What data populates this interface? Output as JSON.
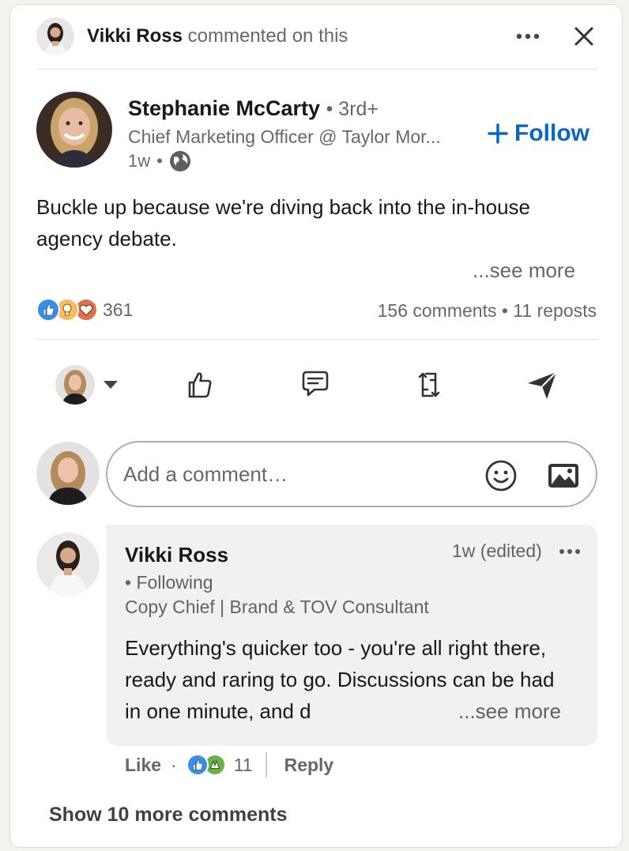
{
  "header": {
    "actor_name": "Vikki Ross",
    "action_text": "commented on this",
    "more_icon": "ellipsis-icon",
    "close_icon": "close-icon"
  },
  "post": {
    "author": {
      "name": "Stephanie McCarty",
      "degree": "3rd+",
      "headline": "Chief Marketing Officer @ Taylor Mor...",
      "time": "1w",
      "visibility_icon": "globe-icon"
    },
    "follow_label": "Follow",
    "text": "Buckle up because we're diving back into the in-house agency debate.",
    "see_more": "...see more",
    "reaction_count": "361",
    "reaction_icons": [
      "like-icon",
      "insightful-icon",
      "love-icon"
    ],
    "comments_reposts": "156 comments • 11 reposts"
  },
  "actions": {
    "items": [
      "reaction-picker",
      "like-icon",
      "comment-icon",
      "repost-icon",
      "send-icon"
    ]
  },
  "comment_box": {
    "placeholder": "Add a comment…"
  },
  "comment": {
    "author_name": "Vikki Ross",
    "time": "1w (edited)",
    "following": "• Following",
    "headline": "Copy Chief | Brand & TOV Consultant",
    "text": "Everything's quicker too - you're all right there, ready and raring to go. Discussions can be had in one minute, and d",
    "see_more": "...see more",
    "like_label": "Like",
    "reaction_count": "11",
    "reply_label": "Reply"
  },
  "show_more": "Show 10 more comments",
  "colors": {
    "accent": "#0a66c2",
    "like": "#378fe9",
    "insightful": "#f5bb5c",
    "love": "#df704d",
    "support": "#6dae4f"
  }
}
